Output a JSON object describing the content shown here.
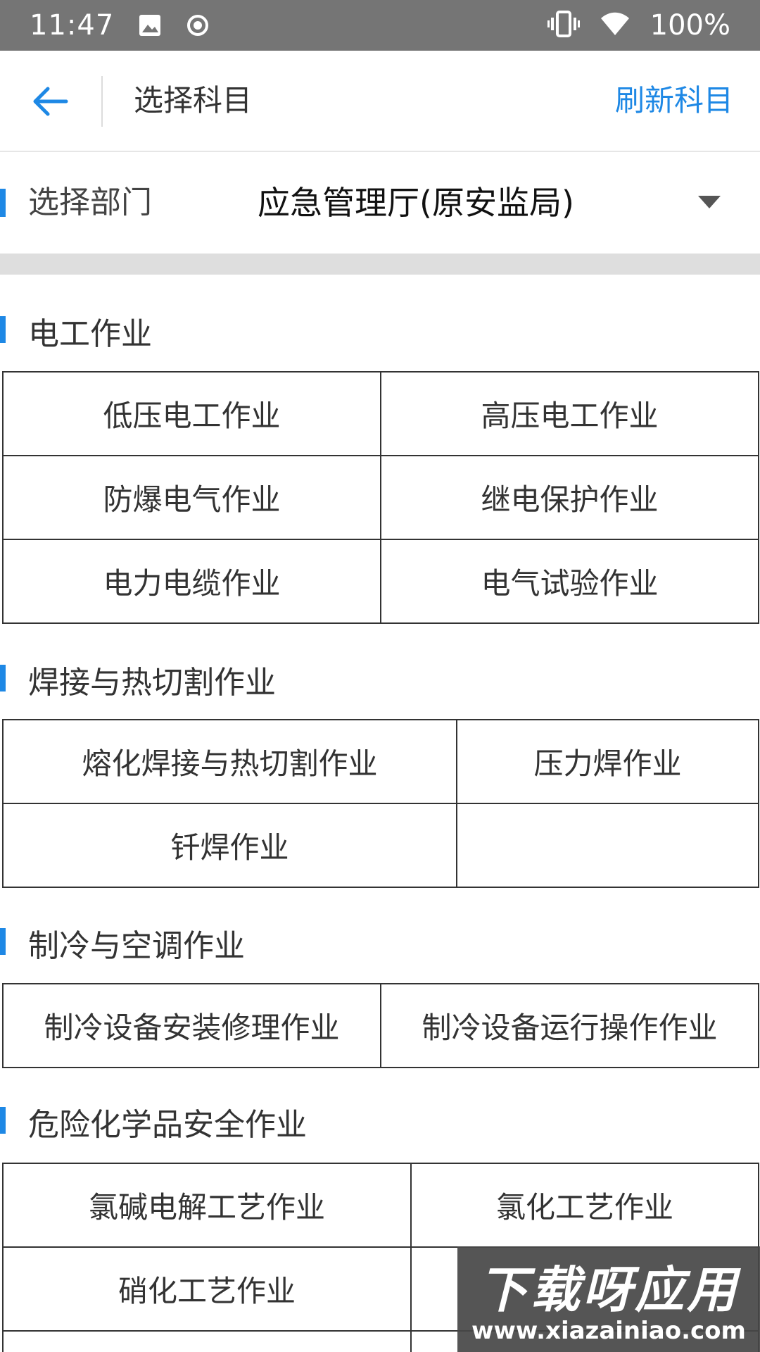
{
  "status_bar": {
    "time": "11:47",
    "left_icons": [
      "image-icon",
      "record-icon"
    ],
    "right_icons": [
      "vibrate-icon",
      "wifi-icon"
    ],
    "battery": "100%"
  },
  "app_bar": {
    "back_icon": "arrow-left-icon",
    "title": "选择科目",
    "refresh_label": "刷新科目"
  },
  "department": {
    "label": "选择部门",
    "value": "应急管理厅(原安监局)",
    "dropdown_icon": "caret-down-icon"
  },
  "sections": [
    {
      "title": "电工作业",
      "items": [
        "低压电工作业",
        "高压电工作业",
        "防爆电气作业",
        "继电保护作业",
        "电力电缆作业",
        "电气试验作业"
      ]
    },
    {
      "title": "焊接与热切割作业",
      "items": [
        "熔化焊接与热切割作业",
        "压力焊作业",
        "钎焊作业",
        ""
      ]
    },
    {
      "title": "制冷与空调作业",
      "items": [
        "制冷设备安装修理作业",
        "制冷设备运行操作作业"
      ]
    },
    {
      "title": "危险化学品安全作业",
      "items": [
        "氯碱电解工艺作业",
        "氯化工艺作业",
        "硝化工艺作业",
        "",
        "",
        ""
      ]
    }
  ],
  "watermark": {
    "title": "下载呀应用",
    "url": "www.xiazainiao.com"
  },
  "colors": {
    "accent": "#1e88e5",
    "status_bar": "#757575",
    "divider_band": "#dedede",
    "grid_border": "#333333"
  }
}
